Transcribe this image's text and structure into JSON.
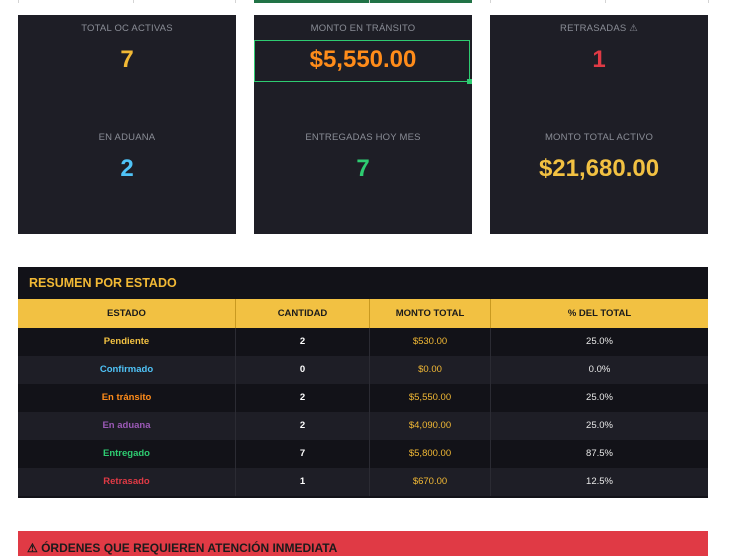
{
  "kpis": [
    {
      "label": "TOTAL OC ACTIVAS",
      "value": "7",
      "color": "#f2b935"
    },
    {
      "label": "MONTO EN TRÁNSITO",
      "value": "$5,550.00",
      "color": "#ff8c1a"
    },
    {
      "label": "RETRASADAS ⚠",
      "value": "1",
      "color": "#e03a45"
    },
    {
      "label": "EN ADUANA",
      "value": "2",
      "color": "#4fc3f7"
    },
    {
      "label": "ENTREGADAS HOY MES",
      "value": "7",
      "color": "#2ecc71"
    },
    {
      "label": "MONTO TOTAL ACTIVO",
      "value": "$21,680.00",
      "color": "#f2c142"
    }
  ],
  "summary": {
    "title": "RESUMEN POR ESTADO",
    "headers": [
      "ESTADO",
      "CANTIDAD",
      "MONTO TOTAL",
      "% DEL TOTAL"
    ],
    "rows": [
      {
        "estado": "Pendiente",
        "cantidad": "2",
        "monto": "$530.00",
        "pct": "25.0%",
        "color": "#f2c142"
      },
      {
        "estado": "Confirmado",
        "cantidad": "0",
        "monto": "$0.00",
        "pct": "0.0%",
        "color": "#4fc3f7"
      },
      {
        "estado": "En tránsito",
        "cantidad": "2",
        "monto": "$5,550.00",
        "pct": "25.0%",
        "color": "#ff8c1a"
      },
      {
        "estado": "En aduana",
        "cantidad": "2",
        "monto": "$4,090.00",
        "pct": "25.0%",
        "color": "#9b59b6"
      },
      {
        "estado": "Entregado",
        "cantidad": "7",
        "monto": "$5,800.00",
        "pct": "87.5%",
        "color": "#2ecc71"
      },
      {
        "estado": "Retrasado",
        "cantidad": "1",
        "monto": "$670.00",
        "pct": "12.5%",
        "color": "#e03a45"
      }
    ]
  },
  "alert": {
    "text": "⚠ ÓRDENES QUE REQUIEREN ATENCIÓN INMEDIATA"
  }
}
